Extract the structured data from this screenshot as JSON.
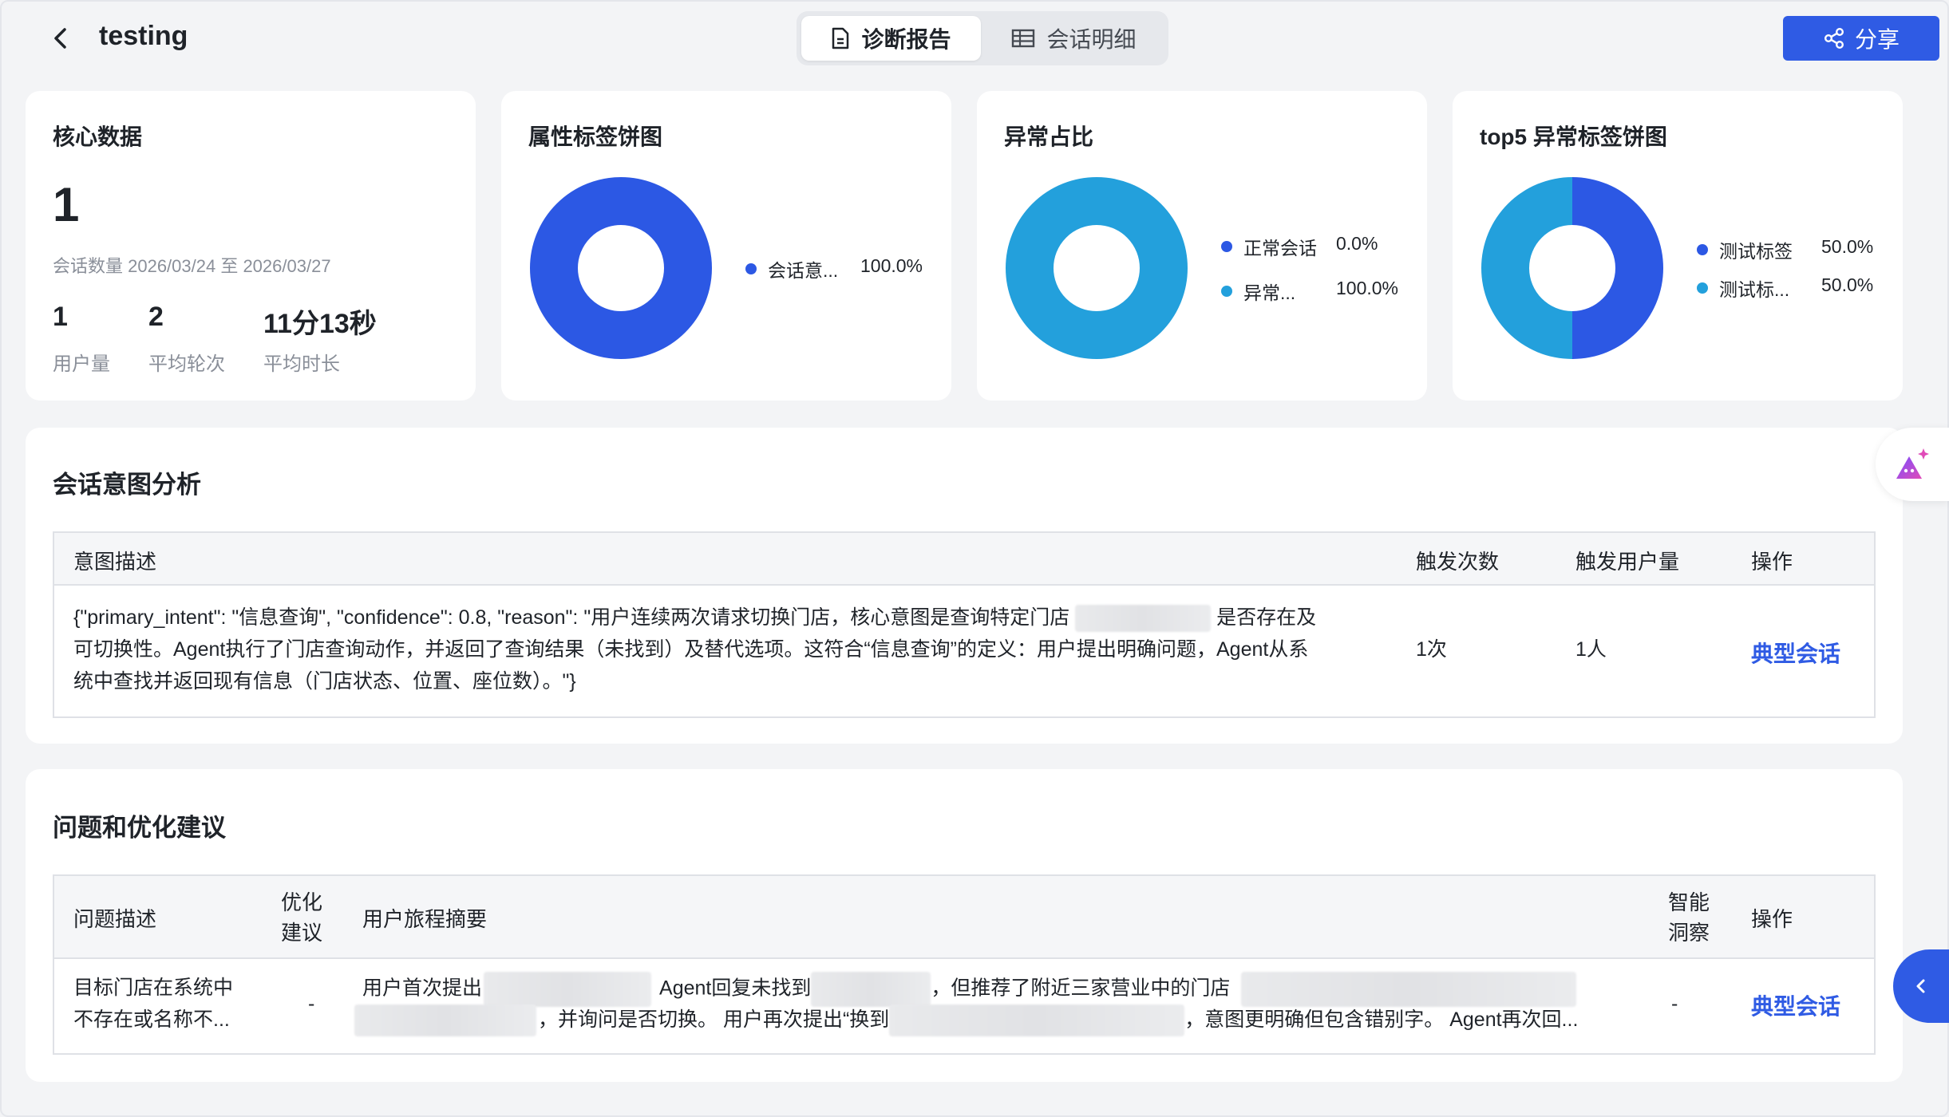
{
  "header": {
    "title": "testing",
    "tabs": [
      {
        "label": "诊断报告",
        "active": true,
        "icon": "document-icon"
      },
      {
        "label": "会话明细",
        "active": false,
        "icon": "table-icon"
      }
    ],
    "share_label": "分享",
    "accent_color": "#2f5be4"
  },
  "core": {
    "title": "核心数据",
    "session_count": "1",
    "session_caption": "会话数量 2026/03/24 至 2026/03/27",
    "stats": [
      {
        "value": "1",
        "label": "用户量"
      },
      {
        "value": "2",
        "label": "平均轮次"
      },
      {
        "value": "11分13秒",
        "label": "平均时长"
      }
    ]
  },
  "chart_data": [
    {
      "type": "pie",
      "title": "属性标签饼图",
      "labels": [
        "会话意..."
      ],
      "values": [
        100.0
      ],
      "value_labels": [
        "100.0%"
      ],
      "colors": [
        "#2c58e4"
      ]
    },
    {
      "type": "pie",
      "title": "异常占比",
      "labels": [
        "正常会话",
        "异常..."
      ],
      "values": [
        0.0,
        100.0
      ],
      "value_labels": [
        "0.0%",
        "100.0%"
      ],
      "colors": [
        "#2c58e4",
        "#23a0dc"
      ]
    },
    {
      "type": "pie",
      "title": "top5 异常标签饼图",
      "labels": [
        "测试标签",
        "测试标..."
      ],
      "values": [
        50.0,
        50.0
      ],
      "value_labels": [
        "50.0%",
        "50.0%"
      ],
      "colors": [
        "#2c58e4",
        "#23a0dc"
      ]
    }
  ],
  "intent": {
    "title": "会话意图分析",
    "columns": [
      "意图描述",
      "触发次数",
      "触发用户量",
      "操作"
    ],
    "row": {
      "desc_line1_a": "{\"primary_intent\": \"信息查询\", \"confidence\": 0.8, \"reason\": \"用户连续两次请求切换门店，核心意图是查询特定门店",
      "desc_line1_b": "是否存在及",
      "desc_line2": "可切换性。Agent执行了门店查询动作，并返回了查询结果（未找到）及替代选项。这符合“信息查询”的定义：用户提出明确问题，Agent从系",
      "desc_line3": "统中查找并返回现有信息（门店状态、位置、座位数）。\"}",
      "count": "1次",
      "users": "1人",
      "action": "典型会话"
    }
  },
  "issues": {
    "title": "问题和优化建议",
    "columns": [
      "问题描述",
      "优化建议",
      "用户旅程摘要",
      "智能洞察",
      "操作"
    ],
    "col2_line1": "优化",
    "col2_line2": "建议",
    "col4_line1": "智能",
    "col4_line2": "洞察",
    "row": {
      "problem_line1": "目标门店在系统中",
      "problem_line2": "不存在或名称不...",
      "suggestion": "-",
      "journey_a": "用户首次提出",
      "journey_b": "Agent回复未找到",
      "journey_c": "，但推荐了附近三家营业中的门店",
      "journey_d": "，并询问是否切换。 用户再次提出“换到",
      "journey_e": "，意图更明确但包含错别字。 Agent再次回...",
      "insight": "-",
      "action": "典型会话"
    }
  }
}
